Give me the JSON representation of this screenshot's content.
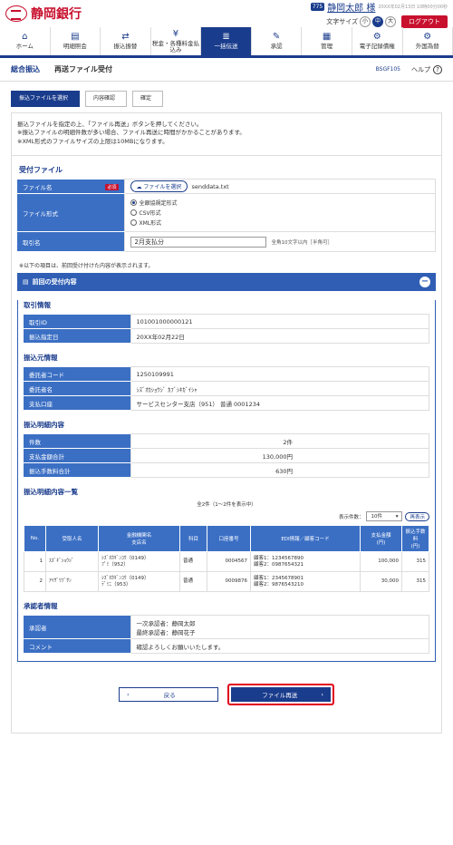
{
  "header": {
    "bank_name": "静岡銀行",
    "user_badge": "775",
    "user_name": "静岡太郎 様",
    "last_login": "20XX年02月13日 10時00分00秒",
    "font_size_label": "文字サイズ",
    "size_small": "小",
    "size_medium": "中",
    "size_large": "大",
    "logout": "ログアウト"
  },
  "nav": [
    {
      "label": "ホーム",
      "icon": "home-icon",
      "glyph": "⌂"
    },
    {
      "label": "明細照会",
      "icon": "document-icon",
      "glyph": "▤"
    },
    {
      "label": "振込振替",
      "icon": "transfer-icon",
      "glyph": "⇄"
    },
    {
      "label": "税金・各種料金払込み",
      "icon": "payment-icon",
      "glyph": "¥"
    },
    {
      "label": "一括伝送",
      "icon": "database-icon",
      "glyph": "≣"
    },
    {
      "label": "承認",
      "icon": "approval-icon",
      "glyph": "✎"
    },
    {
      "label": "管理",
      "icon": "management-icon",
      "glyph": "▦"
    },
    {
      "label": "電子記録債権",
      "icon": "electronic-bond-icon",
      "glyph": "⚙"
    },
    {
      "label": "外国為替",
      "icon": "foreign-exchange-icon",
      "glyph": "⚙"
    }
  ],
  "subheader": {
    "category": "総合振込",
    "title": "再送ファイル受付",
    "code": "BSGF105",
    "help": "ヘルプ"
  },
  "steps": [
    "振込ファイルを選択",
    "内容確認",
    "確定"
  ],
  "intro": [
    "振込ファイルを指定の上、「ファイル再送」ボタンを押してください。",
    "※振込ファイルの明細件数が多い場合、ファイル再送に時間がかかることがあります。",
    "※XML形式のファイルサイズの上限は10MBになります。"
  ],
  "upload": {
    "title": "受付ファイル",
    "file_name_label": "ファイル名",
    "required": "必須",
    "select_file": "ファイルを選択",
    "file_value": "senddata.txt",
    "format_label": "ファイル形式",
    "formats": [
      "全銀協規定形式",
      "CSV形式",
      "XML形式"
    ],
    "trans_name_label": "取引名",
    "trans_name_value": "2月支払分",
    "trans_name_hint": "全角10文字以内［半角可］"
  },
  "note": "※以下の項目は、前回受け付けた内容が表示されます。",
  "previous": {
    "title": "前回の受付内容",
    "trans_info_title": "取引情報",
    "trans_id_label": "取引ID",
    "trans_id_value": "101001000000121",
    "transfer_date_label": "振込指定日",
    "transfer_date_value": "20XX年02月22日",
    "source_title": "振込元情報",
    "client_code_label": "委託者コード",
    "client_code_value": "1250109991",
    "client_name_label": "委託者名",
    "client_name_value": "ｼｽﾞｵｶｼｮｳｼﾞ ｶﾌﾞｼｷｶﾞｲｼｬ",
    "account_label": "支払口座",
    "account_value": "サービスセンター支店（951） 普通 0001234",
    "detail_title": "振込明細内容",
    "count_label": "件数",
    "count_value": "2件",
    "total_label": "支払金額合計",
    "total_value": "130,000円",
    "fee_label": "振込手数料合計",
    "fee_value": "630円",
    "list_title": "振込明細内容一覧",
    "list_meta": "全2件（1～2件を表示中）",
    "per_page_label": "表示件数：",
    "per_page_value": "10件",
    "redisplay": "再表示",
    "columns": [
      "No.",
      "受取人名",
      "金融機関名\n支店名",
      "科目",
      "口座番号",
      "EDI情報／顧客コード",
      "支払金額\n(円)",
      "振込手数料\n(円)"
    ],
    "rows": [
      {
        "no": "1",
        "name": "ｽｽﾞｷﾞｼｮｳｼﾞ",
        "bank": "ｼｽﾞｵｶｷﾞﾝｺｳ（0149）",
        "branch": "ﾌﾟﾐ（952）",
        "type": "普通",
        "acct": "0004567",
        "edi1": "顧客1：1234567890",
        "edi2": "顧客2：0987654321",
        "amount": "100,000",
        "fee": "315"
      },
      {
        "no": "2",
        "name": "ｱｲｻﾞﾜﾌﾞｻﾝ",
        "bank": "ｼｽﾞｵｶｷﾞﾝｺｳ（0149）",
        "branch": "ﾃﾞﾐﾆ（953）",
        "type": "普通",
        "acct": "0009876",
        "edi1": "顧客1：2345678901",
        "edi2": "顧客2：9876543210",
        "amount": "30,000",
        "fee": "315"
      }
    ],
    "approver_title": "承認者情報",
    "approver_label": "承認者",
    "approver1": "一次承認者：静岡太郎",
    "approver2": "最終承認者：静岡花子",
    "comment_label": "コメント",
    "comment_value": "確認よろしくお願いいたします。"
  },
  "actions": {
    "back": "戻る",
    "resend": "ファイル再送"
  }
}
